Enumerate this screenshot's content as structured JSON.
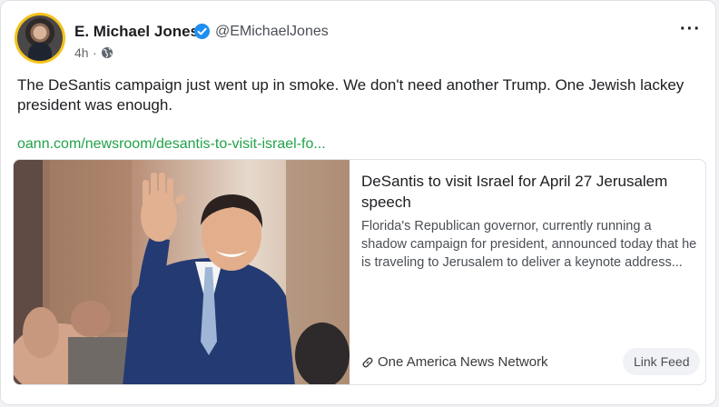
{
  "post": {
    "author_name": "E. Michael Jones",
    "author_handle": "@EMichaelJones",
    "time": "4h",
    "separator": "·",
    "verified": true,
    "visibility_icon": "globe-icon",
    "more_label": "···",
    "text": "The DeSantis campaign just went up in smoke. We don't need another Trump. One Jewish lackey president was enough.",
    "link_text": "oann.com/newsroom/desantis-to-visit-israel-fo..."
  },
  "link_card": {
    "image_icon": "news-photo",
    "title": "DeSantis to visit Israel for April 27 Jerusalem speech",
    "description": "Florida's Republican governor, currently running a shadow campaign for president, announced today that he is traveling to Jerusalem to deliver a keynote address...",
    "source_icon": "link-icon",
    "source": "One America News Network",
    "feed_button": "Link Feed"
  },
  "colors": {
    "link": "#21a24a",
    "verified": "#1d8ff2",
    "avatar_ring": "#f3c21a"
  }
}
